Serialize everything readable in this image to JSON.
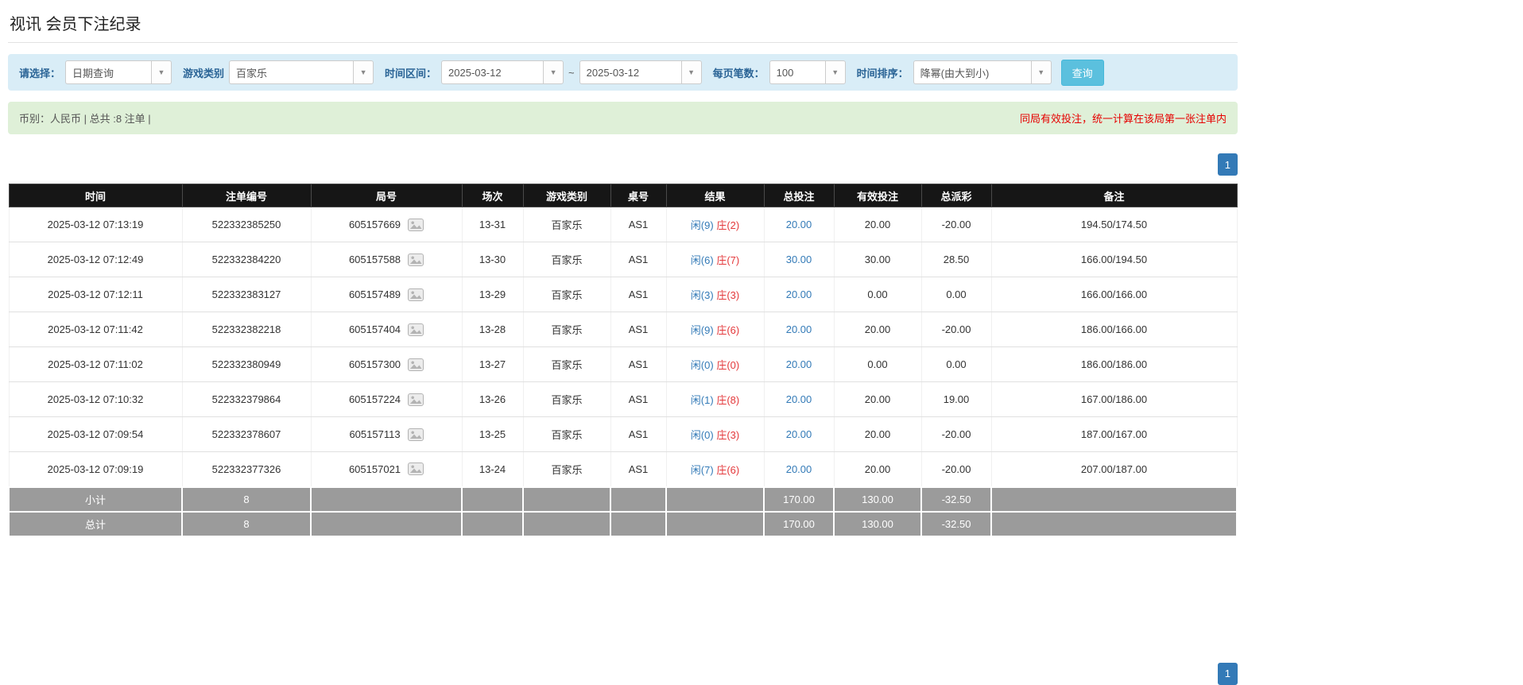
{
  "page": {
    "title": "视讯 会员下注纪录"
  },
  "filters": {
    "select_label": "请选择：",
    "select_value": "日期查询",
    "game_type_label": "游戏类别",
    "game_type_value": "百家乐",
    "date_range_label": "时间区间：",
    "date_from": "2025-03-12",
    "date_separator": "~",
    "date_to": "2025-03-12",
    "page_size_label": "每页笔数：",
    "page_size_value": "100",
    "sort_label": "时间排序：",
    "sort_value": "降幂(由大到小)",
    "search_button": "查询",
    "caret": "▼"
  },
  "summary": {
    "left": "币别：人民币 | 总共 :8 注单 |",
    "right": "同局有效投注，统一计算在该局第一张注单内"
  },
  "pagination": {
    "page": "1"
  },
  "colors": {
    "accent_blue": "#337ab7",
    "negative_red": "#e4393c",
    "filter_bg": "#d9edf7",
    "summary_bg": "#dff0d8",
    "header_bg": "#161616",
    "footer_bg": "#9b9b9b",
    "search_btn": "#5bc0de"
  },
  "icons": {
    "round_image_icon": "image-icon",
    "combo_caret_icon": "chevron-down-icon"
  },
  "table": {
    "headers": [
      "时间",
      "注单编号",
      "局号",
      "场次",
      "游戏类别",
      "桌号",
      "结果",
      "总投注",
      "有效投注",
      "总派彩",
      "备注"
    ],
    "rows": [
      {
        "time": "2025-03-12 07:13:19",
        "order_id": "522332385250",
        "round": "605157669",
        "session": "13-31",
        "game": "百家乐",
        "table_no": "AS1",
        "player": "闲(9)",
        "banker": "庄(2)",
        "total_bet": "20.00",
        "valid_bet": "20.00",
        "payout": "-20.00",
        "note": "194.50/174.50"
      },
      {
        "time": "2025-03-12 07:12:49",
        "order_id": "522332384220",
        "round": "605157588",
        "session": "13-30",
        "game": "百家乐",
        "table_no": "AS1",
        "player": "闲(6)",
        "banker": "庄(7)",
        "total_bet": "30.00",
        "valid_bet": "30.00",
        "payout": "28.50",
        "note": "166.00/194.50"
      },
      {
        "time": "2025-03-12 07:12:11",
        "order_id": "522332383127",
        "round": "605157489",
        "session": "13-29",
        "game": "百家乐",
        "table_no": "AS1",
        "player": "闲(3)",
        "banker": "庄(3)",
        "total_bet": "20.00",
        "valid_bet": "0.00",
        "payout": "0.00",
        "note": "166.00/166.00"
      },
      {
        "time": "2025-03-12 07:11:42",
        "order_id": "522332382218",
        "round": "605157404",
        "session": "13-28",
        "game": "百家乐",
        "table_no": "AS1",
        "player": "闲(9)",
        "banker": "庄(6)",
        "total_bet": "20.00",
        "valid_bet": "20.00",
        "payout": "-20.00",
        "note": "186.00/166.00"
      },
      {
        "time": "2025-03-12 07:11:02",
        "order_id": "522332380949",
        "round": "605157300",
        "session": "13-27",
        "game": "百家乐",
        "table_no": "AS1",
        "player": "闲(0)",
        "banker": "庄(0)",
        "total_bet": "20.00",
        "valid_bet": "0.00",
        "payout": "0.00",
        "note": "186.00/186.00"
      },
      {
        "time": "2025-03-12 07:10:32",
        "order_id": "522332379864",
        "round": "605157224",
        "session": "13-26",
        "game": "百家乐",
        "table_no": "AS1",
        "player": "闲(1)",
        "banker": "庄(8)",
        "total_bet": "20.00",
        "valid_bet": "20.00",
        "payout": "19.00",
        "note": "167.00/186.00"
      },
      {
        "time": "2025-03-12 07:09:54",
        "order_id": "522332378607",
        "round": "605157113",
        "session": "13-25",
        "game": "百家乐",
        "table_no": "AS1",
        "player": "闲(0)",
        "banker": "庄(3)",
        "total_bet": "20.00",
        "valid_bet": "20.00",
        "payout": "-20.00",
        "note": "187.00/167.00"
      },
      {
        "time": "2025-03-12 07:09:19",
        "order_id": "522332377326",
        "round": "605157021",
        "session": "13-24",
        "game": "百家乐",
        "table_no": "AS1",
        "player": "闲(7)",
        "banker": "庄(6)",
        "total_bet": "20.00",
        "valid_bet": "20.00",
        "payout": "-20.00",
        "note": "207.00/187.00"
      }
    ],
    "footer": [
      {
        "label": "小计",
        "count": "8",
        "total_bet": "170.00",
        "valid_bet": "130.00",
        "payout": "-32.50"
      },
      {
        "label": "总计",
        "count": "8",
        "total_bet": "170.00",
        "valid_bet": "130.00",
        "payout": "-32.50"
      }
    ]
  }
}
